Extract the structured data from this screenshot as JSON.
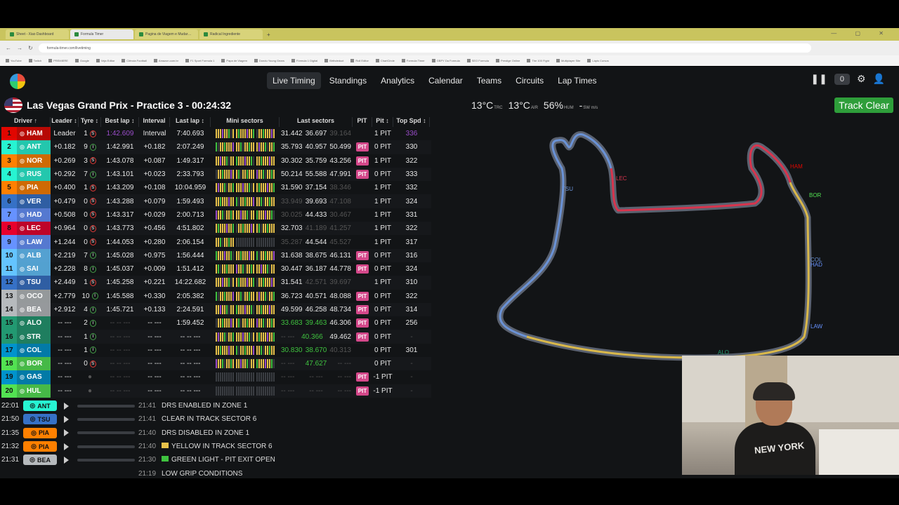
{
  "browser": {
    "tabs": [
      "Sheet - Xiao Dashboard",
      "Formula Timer",
      "Pagina de Viagem e Mudar…",
      "Radical Ingrediente"
    ],
    "url": "formula-timer.com/livetiming",
    "bookmarks": [
      "YouTube",
      "Twitch",
      "PREMIERE",
      "Google",
      "Veja Editar",
      "Ciência Football",
      "Amazon.com.br",
      "F1 Sport Formula 1",
      "Papa de Viagem",
      "Dondu Young Gears",
      "Fórmula 1 Digital",
      "Birthdeduct",
      "Roll Editor",
      "ChartCircle",
      "Formula Timer",
      "GBPY Da Formula",
      "SEO Formula",
      "Prestige Online",
      "The 100 Fight",
      "Multiplayer Site",
      "Lápis Cursos"
    ]
  },
  "nav": {
    "links": [
      "Live Timing",
      "Standings",
      "Analytics",
      "Calendar",
      "Teams",
      "Circuits",
      "Lap Times"
    ],
    "active": "Live Timing",
    "counter": "0"
  },
  "session": {
    "title": "Las Vegas Grand Prix - Practice 3 - 00:24:32",
    "track_temp": "13°C",
    "track_label": "TRC",
    "air_temp": "13°C",
    "air_label": "AIR",
    "humidity": "56%",
    "hum_label": "HUM",
    "wind": "-",
    "wind_label": "SW m/s",
    "status": "Track Clear"
  },
  "table": {
    "headers": [
      "Driver ↑",
      "Leader ↕",
      "Tyre ↕",
      "Best lap ↕",
      "Interval",
      "Last lap ↕",
      "Mini sectors",
      "Last sectors",
      "PIT",
      "Pit ↕",
      "Top Spd ↕"
    ],
    "rows": [
      {
        "pos": "1",
        "code": "HAM",
        "color": "#e10600",
        "leader": "Leader",
        "tyre": "1",
        "comp": "S",
        "best": "1:42.609",
        "bestc": "purple",
        "interval": "Interval",
        "last": "7:40.693",
        "s": [
          "31.442",
          "36.697",
          "39.164"
        ],
        "sc": [
          "",
          "",
          "dim"
        ],
        "pit": false,
        "pitn": "1 PIT",
        "spd": "336",
        "spdc": "purple"
      },
      {
        "pos": "2",
        "code": "ANT",
        "color": "#27f4d2",
        "leader": "+0.182",
        "tyre": "9",
        "comp": "I",
        "best": "1:42.991",
        "bestc": "",
        "interval": "+0.182",
        "last": "2:07.249",
        "s": [
          "35.793",
          "40.957",
          "50.499"
        ],
        "sc": [
          "",
          "",
          ""
        ],
        "pit": true,
        "pitn": "0 PIT",
        "spd": "330",
        "spdc": ""
      },
      {
        "pos": "3",
        "code": "NOR",
        "color": "#ff8000",
        "leader": "+0.269",
        "tyre": "3",
        "comp": "S",
        "best": "1:43.078",
        "bestc": "",
        "interval": "+0.087",
        "last": "1:49.317",
        "s": [
          "30.302",
          "35.759",
          "43.256"
        ],
        "sc": [
          "",
          "",
          ""
        ],
        "pit": true,
        "pitn": "1 PIT",
        "spd": "322",
        "spdc": ""
      },
      {
        "pos": "4",
        "code": "RUS",
        "color": "#27f4d2",
        "leader": "+0.292",
        "tyre": "7",
        "comp": "I",
        "best": "1:43.101",
        "bestc": "",
        "interval": "+0.023",
        "last": "2:33.793",
        "s": [
          "50.214",
          "55.588",
          "47.991"
        ],
        "sc": [
          "",
          "",
          ""
        ],
        "pit": true,
        "pitn": "0 PIT",
        "spd": "333",
        "spdc": ""
      },
      {
        "pos": "5",
        "code": "PIA",
        "color": "#ff8000",
        "leader": "+0.400",
        "tyre": "1",
        "comp": "S",
        "best": "1:43.209",
        "bestc": "",
        "interval": "+0.108",
        "last": "10:04.959",
        "s": [
          "31.590",
          "37.154",
          "38.346"
        ],
        "sc": [
          "",
          "",
          "dim"
        ],
        "pit": false,
        "pitn": "1 PIT",
        "spd": "332",
        "spdc": ""
      },
      {
        "pos": "6",
        "code": "VER",
        "color": "#3671c6",
        "leader": "+0.479",
        "tyre": "0",
        "comp": "S",
        "best": "1:43.288",
        "bestc": "",
        "interval": "+0.079",
        "last": "1:59.493",
        "s": [
          "33.949",
          "39.693",
          "47.108"
        ],
        "sc": [
          "dim",
          "",
          "dim"
        ],
        "pit": false,
        "pitn": "1 PIT",
        "spd": "324",
        "spdc": ""
      },
      {
        "pos": "7",
        "code": "HAD",
        "color": "#6692ff",
        "leader": "+0.508",
        "tyre": "0",
        "comp": "S",
        "best": "1:43.317",
        "bestc": "",
        "interval": "+0.029",
        "last": "2:00.713",
        "s": [
          "30.025",
          "44.433",
          "30.467"
        ],
        "sc": [
          "dim",
          "",
          "dim"
        ],
        "pit": false,
        "pitn": "1 PIT",
        "spd": "331",
        "spdc": ""
      },
      {
        "pos": "8",
        "code": "LEC",
        "color": "#e8002d",
        "leader": "+0.964",
        "tyre": "0",
        "comp": "S",
        "best": "1:43.773",
        "bestc": "",
        "interval": "+0.456",
        "last": "4:51.802",
        "s": [
          "32.703",
          "41.189",
          "41.257"
        ],
        "sc": [
          "",
          "dim",
          "dim"
        ],
        "pit": false,
        "pitn": "1 PIT",
        "spd": "322",
        "spdc": ""
      },
      {
        "pos": "9",
        "code": "LAW",
        "color": "#6692ff",
        "leader": "+1.244",
        "tyre": "0",
        "comp": "S",
        "best": "1:44.053",
        "bestc": "",
        "interval": "+0.280",
        "last": "2:06.154",
        "s": [
          "35.287",
          "44.544",
          "45.527"
        ],
        "sc": [
          "dim",
          "",
          "dim"
        ],
        "pit": false,
        "pitn": "1 PIT",
        "spd": "317",
        "spdc": ""
      },
      {
        "pos": "10",
        "code": "ALB",
        "color": "#64c4ff",
        "leader": "+2.219",
        "tyre": "7",
        "comp": "I",
        "best": "1:45.028",
        "bestc": "",
        "interval": "+0.975",
        "last": "1:56.444",
        "s": [
          "31.638",
          "38.675",
          "46.131"
        ],
        "sc": [
          "",
          "",
          ""
        ],
        "pit": true,
        "pitn": "0 PIT",
        "spd": "316",
        "spdc": ""
      },
      {
        "pos": "11",
        "code": "SAI",
        "color": "#64c4ff",
        "leader": "+2.228",
        "tyre": "8",
        "comp": "I",
        "best": "1:45.037",
        "bestc": "",
        "interval": "+0.009",
        "last": "1:51.412",
        "s": [
          "30.447",
          "36.187",
          "44.778"
        ],
        "sc": [
          "",
          "",
          ""
        ],
        "pit": true,
        "pitn": "0 PIT",
        "spd": "324",
        "spdc": ""
      },
      {
        "pos": "12",
        "code": "TSU",
        "color": "#3671c6",
        "leader": "+2.449",
        "tyre": "1",
        "comp": "S",
        "best": "1:45.258",
        "bestc": "",
        "interval": "+0.221",
        "last": "14:22.682",
        "s": [
          "31.541",
          "42.571",
          "39.697"
        ],
        "sc": [
          "",
          "dim",
          "dim"
        ],
        "pit": false,
        "pitn": "1 PIT",
        "spd": "310",
        "spdc": ""
      },
      {
        "pos": "13",
        "code": "OCO",
        "color": "#b6babd",
        "leader": "+2.779",
        "tyre": "10",
        "comp": "I",
        "best": "1:45.588",
        "bestc": "",
        "interval": "+0.330",
        "last": "2:05.382",
        "s": [
          "36.723",
          "40.571",
          "48.088"
        ],
        "sc": [
          "",
          "",
          ""
        ],
        "pit": true,
        "pitn": "0 PIT",
        "spd": "322",
        "spdc": ""
      },
      {
        "pos": "14",
        "code": "BEA",
        "color": "#b6babd",
        "leader": "+2.912",
        "tyre": "4",
        "comp": "I",
        "best": "1:45.721",
        "bestc": "",
        "interval": "+0.133",
        "last": "2:24.591",
        "s": [
          "49.599",
          "46.258",
          "48.734"
        ],
        "sc": [
          "",
          "",
          ""
        ],
        "pit": true,
        "pitn": "0 PIT",
        "spd": "314",
        "spdc": ""
      },
      {
        "pos": "15",
        "code": "ALO",
        "color": "#229971",
        "leader": "-- ---",
        "tyre": "2",
        "comp": "I",
        "best": "-- -- ---",
        "bestc": "dim",
        "interval": "-- ---",
        "last": "1:59.452",
        "s": [
          "33.683",
          "39.463",
          "46.306"
        ],
        "sc": [
          "green",
          "green",
          ""
        ],
        "pit": true,
        "pitn": "0 PIT",
        "spd": "256",
        "spdc": ""
      },
      {
        "pos": "16",
        "code": "STR",
        "color": "#229971",
        "leader": "-- ---",
        "tyre": "1",
        "comp": "I",
        "best": "-- -- ---",
        "bestc": "dim",
        "interval": "-- ---",
        "last": "-- -- ---",
        "s": [
          "-- ---",
          "40.366",
          "49.462"
        ],
        "sc": [
          "dim",
          "green",
          ""
        ],
        "pit": true,
        "pitn": "0 PIT",
        "spd": "-",
        "spdc": "dim"
      },
      {
        "pos": "17",
        "code": "COL",
        "color": "#0093cc",
        "leader": "-- ---",
        "tyre": "1",
        "comp": "I",
        "best": "-- -- ---",
        "bestc": "dim",
        "interval": "-- ---",
        "last": "-- -- ---",
        "s": [
          "30.830",
          "38.670",
          "40.313"
        ],
        "sc": [
          "green",
          "green",
          "dim"
        ],
        "pit": false,
        "pitn": "0 PIT",
        "spd": "301",
        "spdc": ""
      },
      {
        "pos": "18",
        "code": "BOR",
        "color": "#52e252",
        "leader": "-- ---",
        "tyre": "0",
        "comp": "S",
        "best": "-- -- ---",
        "bestc": "dim",
        "interval": "-- ---",
        "last": "-- -- ---",
        "s": [
          "-- ---",
          "47.627",
          "-- ---"
        ],
        "sc": [
          "dim",
          "green",
          "dim"
        ],
        "pit": false,
        "pitn": "0 PIT",
        "spd": "-",
        "spdc": "dim"
      },
      {
        "pos": "19",
        "code": "GAS",
        "color": "#0093cc",
        "leader": "-- ---",
        "tyre": "",
        "comp": "",
        "best": "-- -- ---",
        "bestc": "dim",
        "interval": "-- ---",
        "last": "-- -- ---",
        "s": [
          "-- ---",
          "-- ---",
          "-- ---"
        ],
        "sc": [
          "dim",
          "dim",
          "dim"
        ],
        "pit": true,
        "pitn": "-1 PIT",
        "spd": "-",
        "spdc": "dim"
      },
      {
        "pos": "20",
        "code": "HUL",
        "color": "#52e252",
        "leader": "-- ---",
        "tyre": "",
        "comp": "",
        "best": "-- -- ---",
        "bestc": "dim",
        "interval": "-- ---",
        "last": "-- -- ---",
        "s": [
          "-- ---",
          "-- ---",
          "-- ---"
        ],
        "sc": [
          "dim",
          "dim",
          "dim"
        ],
        "pit": true,
        "pitn": "-1 PIT",
        "spd": "-",
        "spdc": "dim"
      }
    ]
  },
  "radio": [
    {
      "time": "22:01",
      "code": "ANT",
      "color": "#27f4d2"
    },
    {
      "time": "21:50",
      "code": "TSU",
      "color": "#3671c6"
    },
    {
      "time": "21:35",
      "code": "PIA",
      "color": "#ff8000"
    },
    {
      "time": "21:32",
      "code": "PIA",
      "color": "#ff8000"
    },
    {
      "time": "21:31",
      "code": "BEA",
      "color": "#b6babd"
    }
  ],
  "race_control": [
    {
      "time": "21:41",
      "text": "DRS ENABLED IN ZONE 1",
      "flag": ""
    },
    {
      "time": "21:41",
      "text": "CLEAR IN TRACK SECTOR 6",
      "flag": ""
    },
    {
      "time": "21:40",
      "text": "DRS DISABLED IN ZONE 1",
      "flag": ""
    },
    {
      "time": "21:40",
      "text": "YELLOW IN TRACK SECTOR 6",
      "flag": "#e7c14a"
    },
    {
      "time": "21:30",
      "text": "GREEN LIGHT - PIT EXIT OPEN",
      "flag": "#3fc23f"
    },
    {
      "time": "21:19",
      "text": "LOW GRIP CONDITIONS",
      "flag": ""
    }
  ],
  "map_labels": [
    "TSU",
    "LEC",
    "HAM",
    "BOR",
    "COL",
    "HAD",
    "LAW",
    "ALO"
  ],
  "colors": {
    "pit_badge": "#d4488a",
    "track_clear": "#2e9e3a",
    "best_purple": "#9b4dca",
    "personal_green": "#3fc23f"
  }
}
